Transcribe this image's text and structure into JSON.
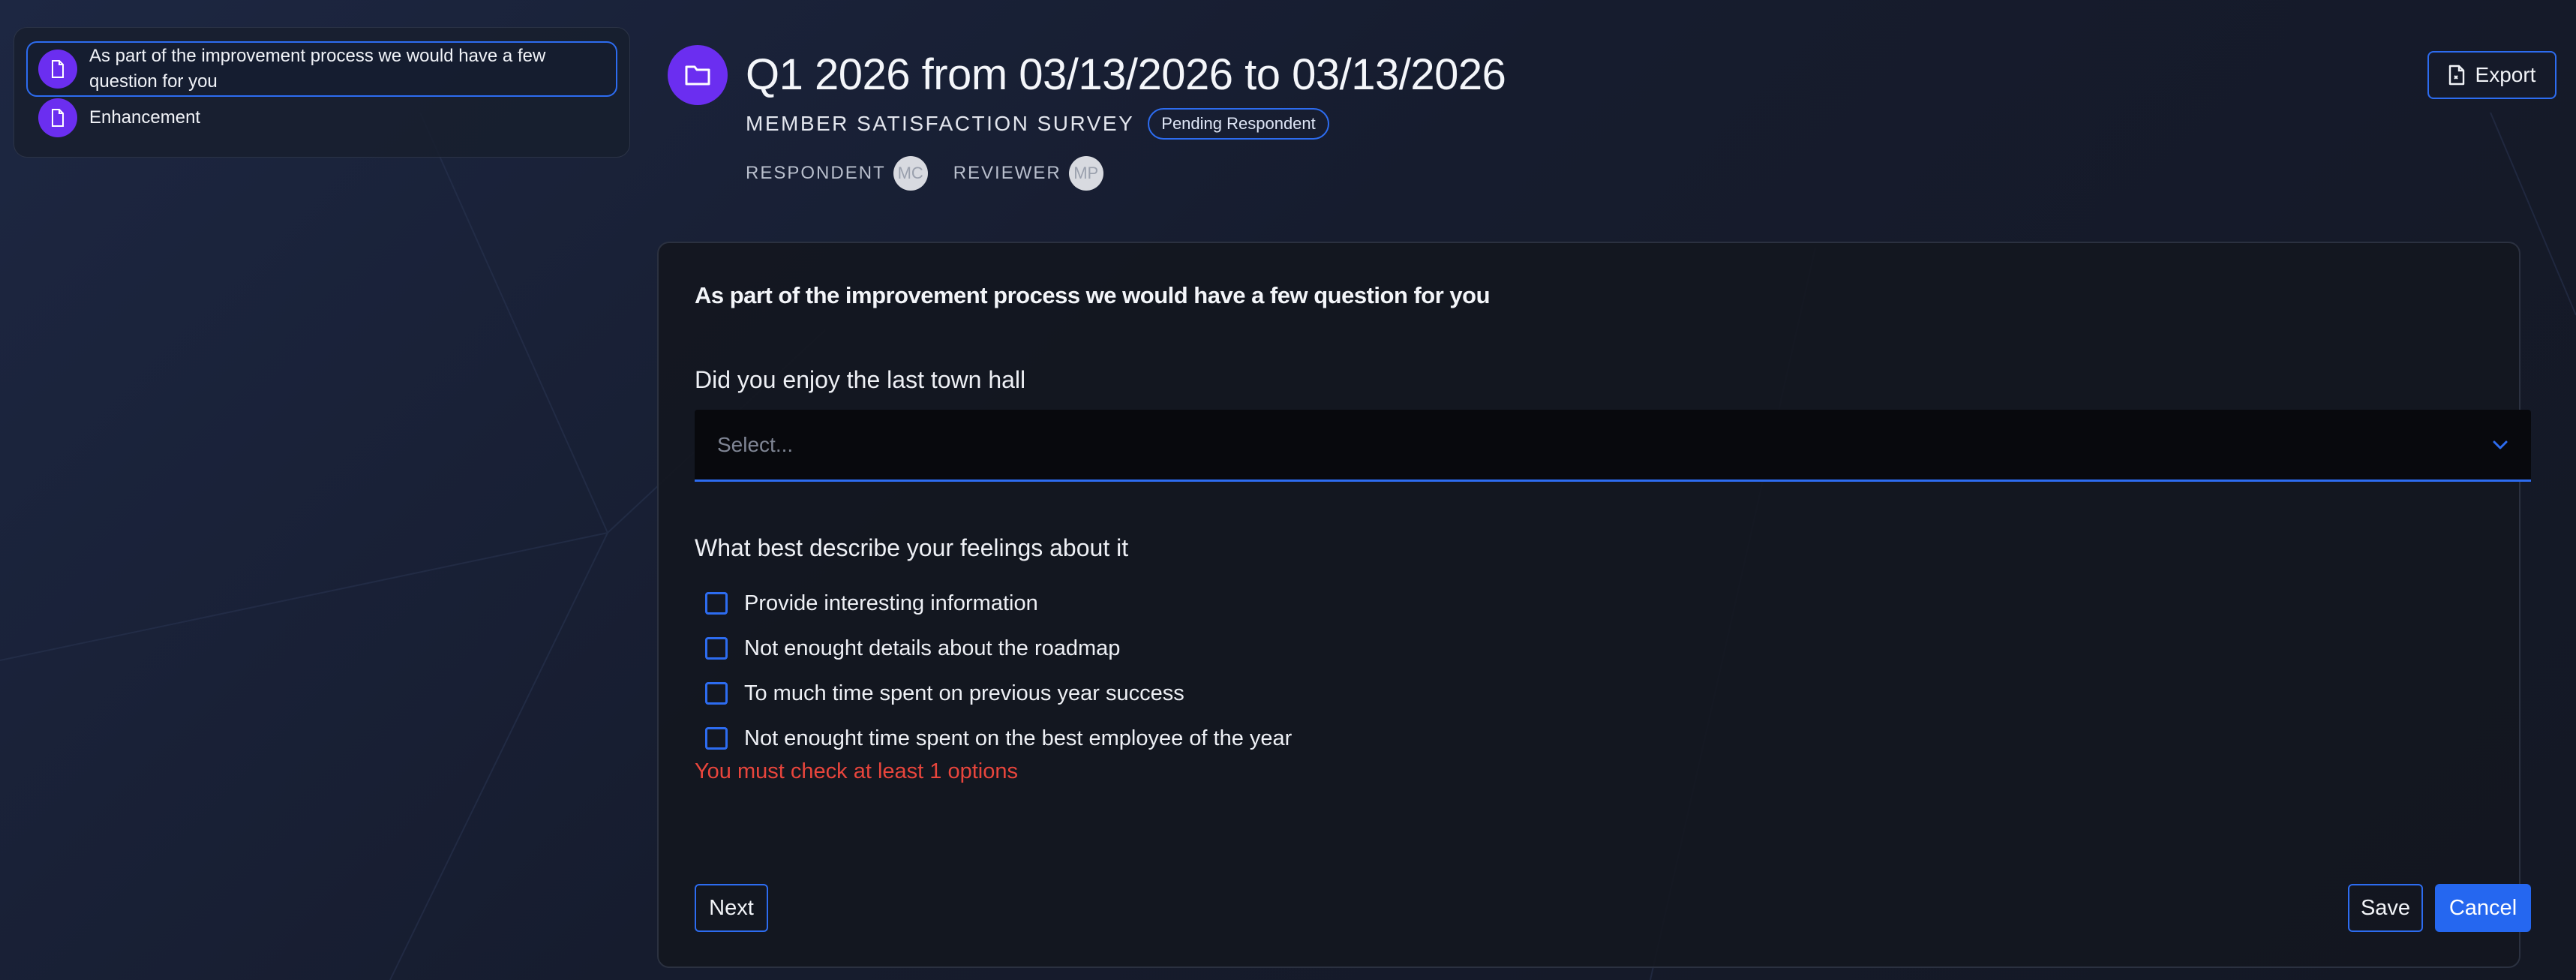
{
  "colors": {
    "accent": "#2d6cf0",
    "icon_circle": "#6b2ef0",
    "error": "#e8453c",
    "primary_button": "#2567f0"
  },
  "sidebar": {
    "items": [
      {
        "label": "As part of the improvement process we would have a few question for you",
        "icon": "document-icon",
        "active": true
      },
      {
        "label": "Enhancement",
        "icon": "document-icon",
        "active": false
      }
    ]
  },
  "header": {
    "icon": "folder-icon",
    "title": "Q1 2026 from 03/13/2026 to 03/13/2026",
    "subtitle": "MEMBER SATISFACTION SURVEY",
    "status_badge": "Pending Respondent",
    "respondent_label": "RESPONDENT",
    "respondent_initials": "MC",
    "reviewer_label": "REVIEWER",
    "reviewer_initials": "MP",
    "export_label": "Export",
    "export_icon": "file-export-icon"
  },
  "form": {
    "section_title": "As part of the improvement process we would have a few question for you",
    "question1": {
      "label": "Did you enjoy the last town hall",
      "placeholder": "Select...",
      "icon": "chevron-down-icon"
    },
    "question2": {
      "label": "What best describe your feelings about it",
      "options": [
        "Provide interesting information",
        "Not enought details about the roadmap",
        "To much time spent on previous year success",
        "Not enought time spent on the best employee of the year"
      ],
      "error": "You must check at least 1 options"
    },
    "next_label": "Next",
    "save_label": "Save",
    "cancel_label": "Cancel"
  }
}
